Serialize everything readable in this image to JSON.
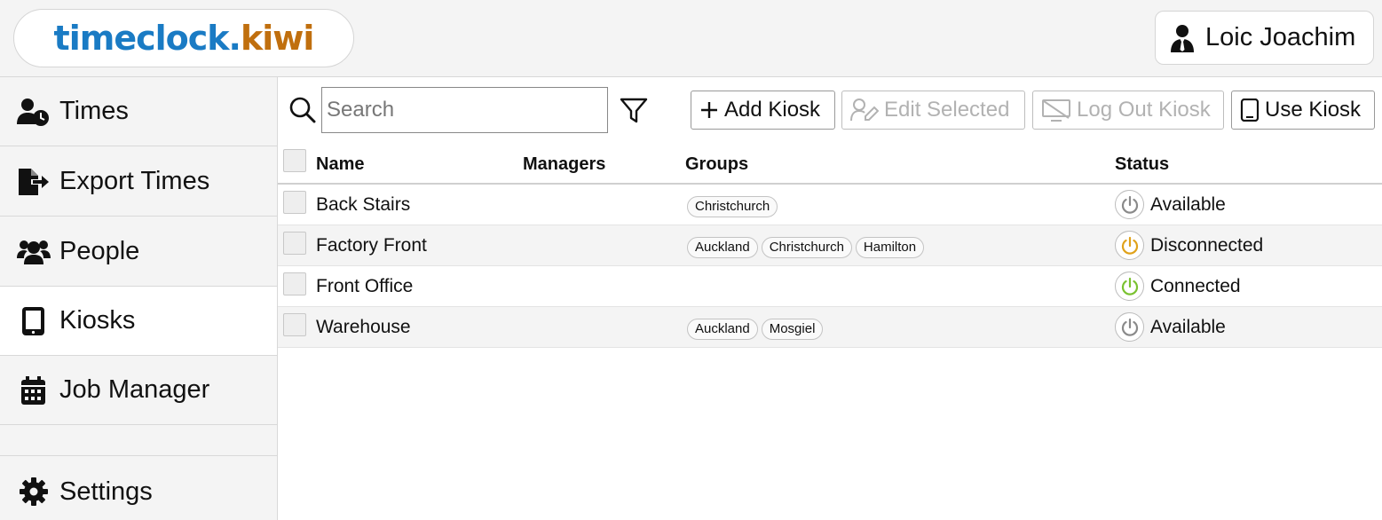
{
  "header": {
    "logo_part1": "timeclock.",
    "logo_part2": "kiwi",
    "user_name": "Loic Joachim"
  },
  "sidebar": {
    "items": [
      {
        "label": "Times",
        "icon": "user-clock-icon"
      },
      {
        "label": "Export Times",
        "icon": "file-export-icon"
      },
      {
        "label": "People",
        "icon": "users-icon"
      },
      {
        "label": "Kiosks",
        "icon": "tablet-icon",
        "active": true
      },
      {
        "label": "Job Manager",
        "icon": "calendar-icon"
      },
      {
        "label": "Settings",
        "icon": "gear-icon"
      }
    ]
  },
  "toolbar": {
    "search_placeholder": "Search",
    "search_value": "",
    "add_label": "Add Kiosk",
    "edit_label": "Edit Selected",
    "logout_label": "Log Out Kiosk",
    "use_label": "Use Kiosk"
  },
  "table": {
    "headers": {
      "name": "Name",
      "managers": "Managers",
      "groups": "Groups",
      "status": "Status"
    },
    "rows": [
      {
        "name": "Back Stairs",
        "managers": "",
        "groups": [
          "Christchurch"
        ],
        "status": "Available",
        "status_color": "#8a8a8a"
      },
      {
        "name": "Factory Front",
        "managers": "",
        "groups": [
          "Auckland",
          "Christchurch",
          "Hamilton"
        ],
        "status": "Disconnected",
        "status_color": "#e0a21a"
      },
      {
        "name": "Front Office",
        "managers": "",
        "groups": [],
        "status": "Connected",
        "status_color": "#7ac230"
      },
      {
        "name": "Warehouse",
        "managers": "",
        "groups": [
          "Auckland",
          "Mosgiel"
        ],
        "status": "Available",
        "status_color": "#8a8a8a"
      }
    ]
  },
  "colors": {
    "logo_blue": "#1a7bc4",
    "logo_orange": "#c06f0e"
  }
}
